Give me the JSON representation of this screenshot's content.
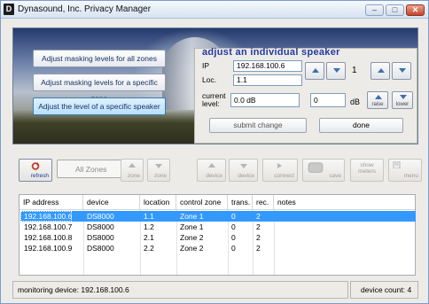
{
  "window": {
    "title": "Dynasound, Inc.  Privacy Manager",
    "icon_letter": "D",
    "buttons": {
      "minimize": "–",
      "maximize": "□",
      "close": "✕"
    }
  },
  "left_buttons": [
    {
      "label": "Adjust masking levels for all zones"
    },
    {
      "label": "Adjust masking levels for a specific zone"
    },
    {
      "label": "Adjust the level of a specific speaker"
    }
  ],
  "adjust_panel": {
    "title": "adjust an individual speaker",
    "ip_label": "IP",
    "ip_value": "192.168.100.6",
    "loc_label": "Loc.",
    "loc_value": "1.1",
    "number_value": "1",
    "current_level_label_1": "current",
    "current_level_label_2": "level:",
    "current_level_value": "0.0 dB",
    "step_value": "0",
    "step_unit": "dB",
    "raise_label": "raise",
    "lower_label": "lower",
    "submit_label": "submit change",
    "done_label": "done"
  },
  "toolbar": {
    "refresh_label": "refresh",
    "zones_value": "All Zones",
    "zone_up_label": "zone",
    "zone_down_label": "zone",
    "device_up_label": "device",
    "device_down_label": "device",
    "connect_label": "connect",
    "save_label": "save",
    "show_meters_label_1": "show",
    "show_meters_label_2": "meters",
    "menu_label": "menu"
  },
  "table": {
    "columns": [
      "IP address",
      "device",
      "location",
      "control zone",
      "trans.",
      "rec.",
      "notes"
    ],
    "rows": [
      [
        "192.168.100.6",
        "DS8000",
        "1.1",
        "Zone 1",
        "0",
        "2",
        ""
      ],
      [
        "192.168.100.7",
        "DS8000",
        "1.2",
        "Zone 1",
        "0",
        "2",
        ""
      ],
      [
        "192.168.100.8",
        "DS8000",
        "2.1",
        "Zone 2",
        "0",
        "2",
        ""
      ],
      [
        "192.168.100.9",
        "DS8000",
        "2.2",
        "Zone 2",
        "0",
        "2",
        ""
      ]
    ],
    "selected_row": 0
  },
  "status": {
    "monitoring": "monitoring device: 192.168.100.6",
    "device_count": "device count: 4"
  },
  "colors": {
    "selection": "#3399ff",
    "panel_title": "#2239a2",
    "button_text": "#14305e"
  }
}
